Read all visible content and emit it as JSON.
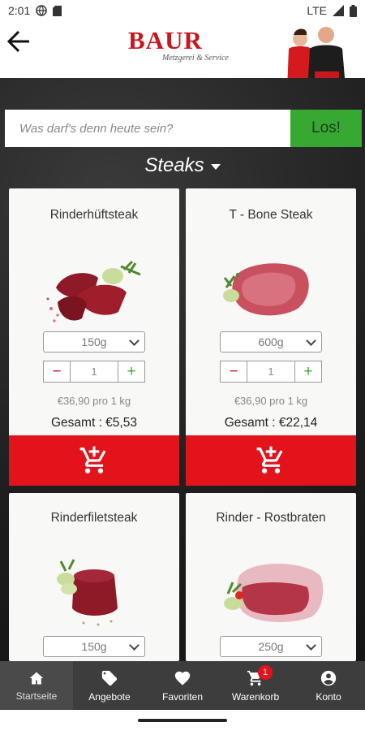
{
  "status": {
    "time": "2:01",
    "network": "LTE"
  },
  "header": {
    "brand": "BAUR",
    "tagline": "Metzgerei & Service"
  },
  "search": {
    "placeholder": "Was darf's denn heute sein?",
    "button": "Los!"
  },
  "category": {
    "label": "Steaks"
  },
  "products": [
    {
      "name": "Rinderhüftsteak",
      "weight": "150g",
      "qty": "1",
      "price": "€36,90 pro 1 kg",
      "total": "Gesamt : €5,53"
    },
    {
      "name": "T - Bone Steak",
      "weight": "600g",
      "qty": "1",
      "price": "€36,90 pro 1 kg",
      "total": "Gesamt : €22,14"
    },
    {
      "name": "Rinderfiletsteak",
      "weight": "150g"
    },
    {
      "name": "Rinder - Rostbraten",
      "weight": "250g"
    }
  ],
  "nav": [
    {
      "label": "Startseite",
      "icon": "home-icon"
    },
    {
      "label": "Angebote",
      "icon": "tag-icon"
    },
    {
      "label": "Favoriten",
      "icon": "heart-icon"
    },
    {
      "label": "Warenkorb",
      "icon": "cart-icon",
      "badge": "1"
    },
    {
      "label": "Konto",
      "icon": "account-icon"
    }
  ],
  "colors": {
    "accent_red": "#e2131b",
    "accent_green": "#37a832",
    "nav_bg": "#3d3d3d"
  }
}
